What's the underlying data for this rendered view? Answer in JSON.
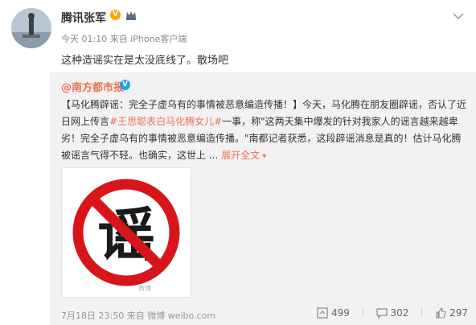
{
  "post": {
    "author": "腾讯张军",
    "vip_badge": "V",
    "timestamp": "今天 01:10",
    "source_prefix": "来自",
    "source": "iPhone客户端",
    "text": "这种造谣实在是太没底线了。散场吧"
  },
  "repost": {
    "author": "@南方都市报",
    "vip_badge": "V",
    "body_part1": "【马化腾辟谣：完全子虚乌有的事情被恶意编造传播！】今天，马化腾在朋友圈辟谣，否认了近日网上传言",
    "hashtag": "#王思聪表白马化腾女儿#",
    "body_part2": "一事，称\"这两天集中爆发的针对我家人的谣言越来越卑劣！完全子虚乌有的事情被恶意编造传播。\"南都记者获悉，这段辟谣消息是真的！估计马化腾被谣言气得不轻。也确实，这世上 ...",
    "expand_label": "展开全文",
    "image_text": "谣",
    "image_watermark": "微博",
    "timestamp": "7月18日 23:50",
    "source_prefix": "来自",
    "source": "微博 weibo.com",
    "repost_count": "499",
    "comment_count": "302",
    "like_count": "297"
  },
  "colors": {
    "link": "#eb7350",
    "vip_orange": "#f7a800",
    "vip_blue": "#1e9fe5",
    "ban_red": "#d7161b"
  }
}
